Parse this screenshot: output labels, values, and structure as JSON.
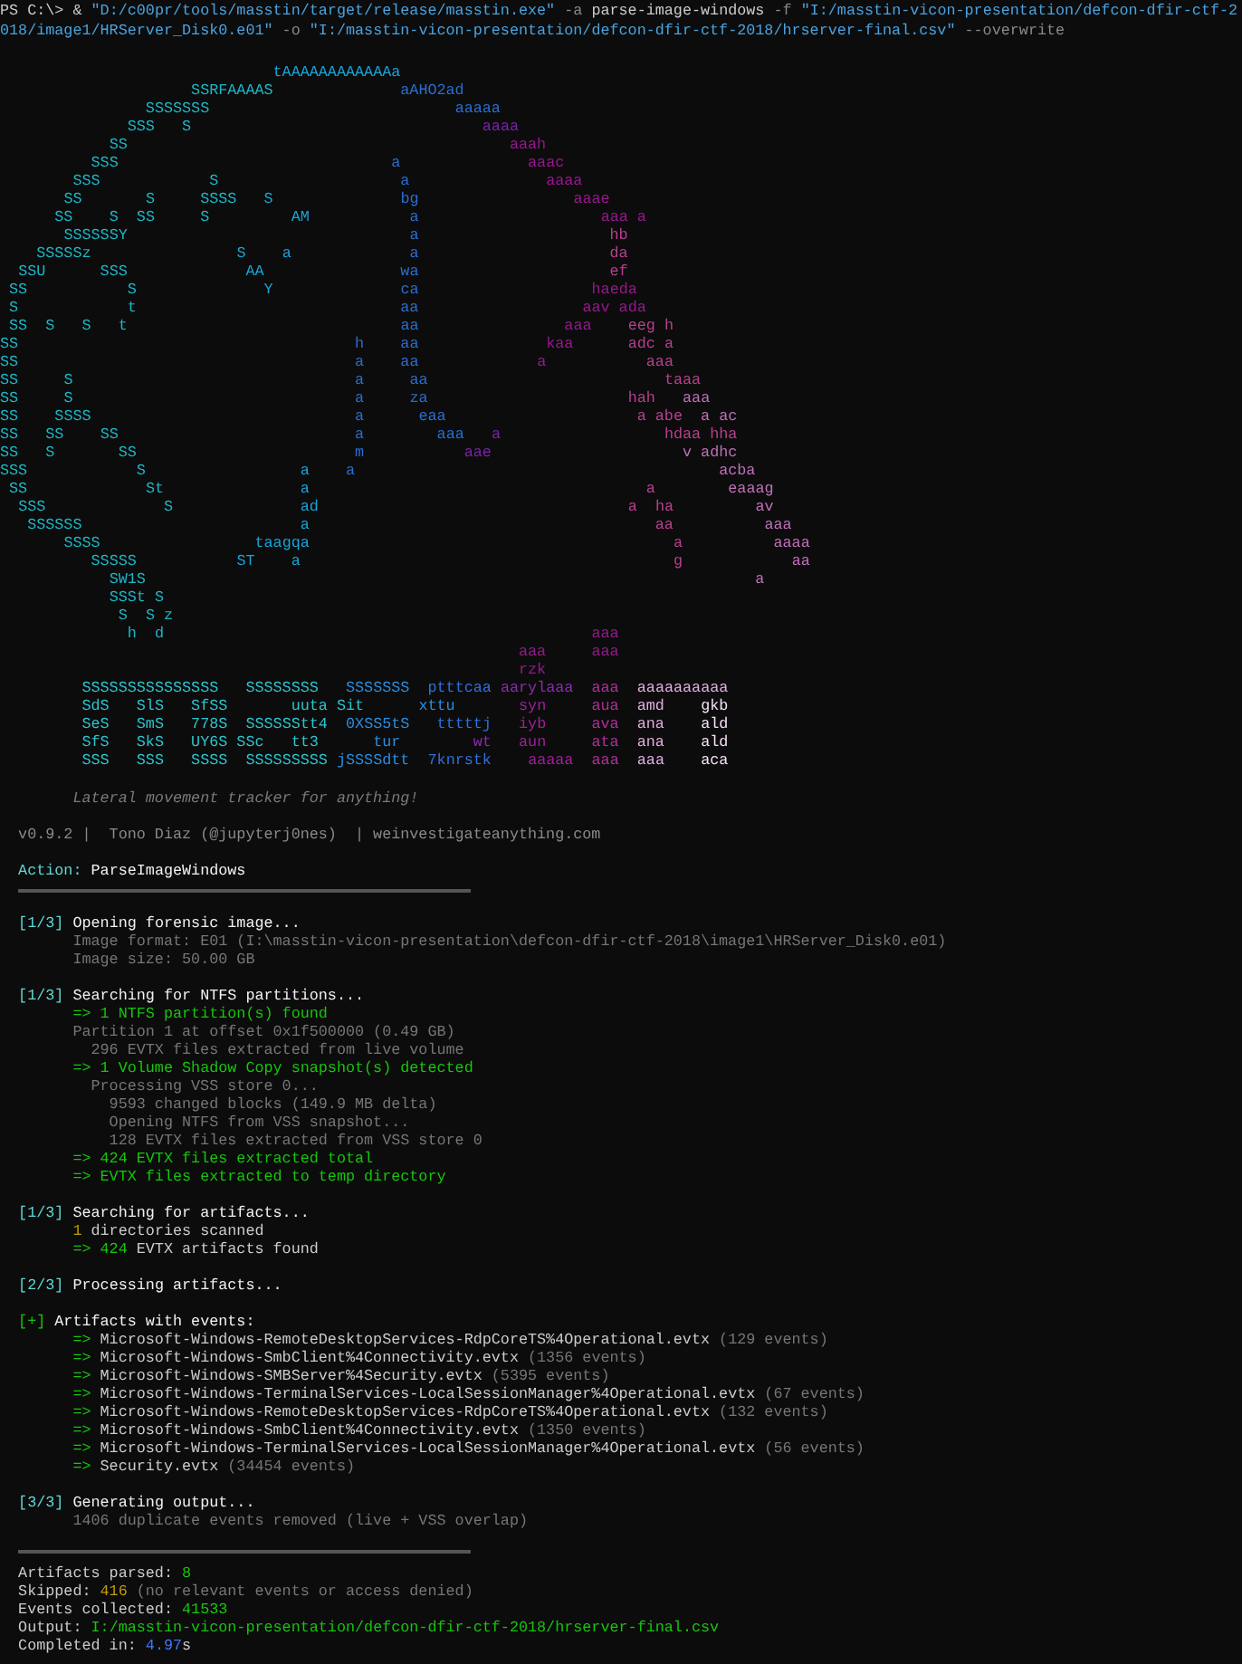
{
  "command": [
    {
      "text": "PS C:\\> & ",
      "kind": "plain"
    },
    {
      "text": "\"D:/c00pr/tools/masstin/target/release/masstin.exe\"",
      "kind": "string"
    },
    {
      "text": " -a ",
      "kind": "flag"
    },
    {
      "text": "parse-image-windows",
      "kind": "plain"
    },
    {
      "text": " -f ",
      "kind": "flag"
    },
    {
      "text": "\"I:/masstin-vicon-presentation/defcon-dfir-ctf-2018/image1/HRServer_Disk0.e01\"",
      "kind": "string"
    },
    {
      "text": " -o ",
      "kind": "flag"
    },
    {
      "text": "\"I:/masstin-vicon-presentation/defcon-dfir-ctf-2018/hrserver-final.csv\"",
      "kind": "string"
    },
    {
      "text": " --overwrite",
      "kind": "flag"
    }
  ],
  "banner": {
    "art": [
      [
        "                              tAAAAAAAAAAAAa"
      ],
      [
        "                     SSRFAAAAS",
        "              aAHO2ad"
      ],
      [
        "                SSSSSSS",
        "                           aaaaa"
      ],
      [
        "              SSS",
        "   S",
        "                                aaaa"
      ],
      [
        "            SS",
        "                                          aaah"
      ],
      [
        "          SSS",
        "                              a",
        "              aaac"
      ],
      [
        "        SSS",
        "            S",
        "                    a",
        "               aaaa"
      ],
      [
        "       SS",
        "       S",
        "     SSSS",
        "   S",
        "              bg",
        "                 aaae"
      ],
      [
        "      SS",
        "    S",
        "  SS",
        "     S",
        "         AM",
        "           a",
        "                    aaa a"
      ],
      [
        "       SSSSSSY",
        "                               a",
        "                     hb"
      ],
      [
        "    SSSSSz",
        "                S",
        "    a",
        "             a",
        "                     da"
      ],
      [
        "  SSU",
        "      SSS",
        "             AA",
        "               wa",
        "                     ef"
      ],
      [
        " SS",
        "           S",
        "              Y",
        "              ca",
        "                   haeda"
      ],
      [
        " S",
        "            t",
        "                             aa",
        "                  aav ada"
      ],
      [
        " SS",
        "  S",
        "   S",
        "   t",
        "                              aa",
        "                aaa",
        "    eeg h"
      ],
      [
        "SS",
        "                                     h",
        "    aa",
        "              kaa",
        "      adc a"
      ],
      [
        "SS",
        "                                     a",
        "    aa",
        "             a",
        "           aaa"
      ],
      [
        "SS",
        "     S",
        "                               a",
        "     aa",
        "                          taaa"
      ],
      [
        "SS",
        "     S",
        "                               a",
        "     za",
        "                      hah",
        "   aaa"
      ],
      [
        "SS",
        "    SSSS",
        "                             a",
        "      eaa",
        "                     a abe",
        "  a ac"
      ],
      [
        "SS",
        "   SS",
        "    SS",
        "                          a",
        "        aaa",
        "   a",
        "                  hdaa hha"
      ],
      [
        "SS",
        "   S",
        "       SS",
        "                        m",
        "           aae",
        "                     v adhc"
      ],
      [
        "SSS",
        "            S",
        "                 a",
        "    a",
        "                                        acba"
      ],
      [
        " SS",
        "             St",
        "               a",
        "                                     a",
        "        eaaag"
      ],
      [
        "  SSS",
        "             S",
        "              ad",
        "                                  a",
        "  ha",
        "         av"
      ],
      [
        "   SSSSSS",
        "                        a",
        "                                      aa",
        "          aaa"
      ],
      [
        "       SSSS",
        "                 taagqa",
        "                                        a",
        "          aaaa"
      ],
      [
        "          SSSSS",
        "           ST",
        "    a",
        "                                         g",
        "            aa"
      ],
      [
        "            SW1S",
        "                                                                   a"
      ],
      [
        "            SSSt S"
      ],
      [
        "             S",
        "  S z"
      ],
      [
        "              h",
        "  d",
        "                                               aaa"
      ],
      [
        "                                                         aaa",
        "     aaa"
      ],
      [
        "                                                         rzk"
      ],
      [
        "         SSSSSSSSSSSSSSS",
        "   SSSSSSSS",
        "   SSSSSSS",
        "  ptttcaa",
        " aarylaaa",
        "  aaa",
        "  aaaaaaaaaa"
      ],
      [
        "         SdS",
        "   SlS",
        "   SfSS",
        "       uuta Sit",
        "      xttu",
        "       syn",
        "     aua",
        "  amd",
        "    gkb"
      ],
      [
        "         SeS",
        "   SmS",
        "   778S",
        "  SSSSSStt4",
        "  0XSS5tS",
        "   tttttj",
        "   iyb",
        "     ava",
        "  ana",
        "    ald"
      ],
      [
        "         SfS",
        "   SkS",
        "   UY6S SSc",
        "   tt3",
        "      tur",
        "        wt",
        "   aun",
        "     ata",
        "  ana",
        "    ald"
      ],
      [
        "         SSS",
        "   SSS",
        "   SSSS",
        "  SSSSSSSSS",
        " jSSSSdtt",
        "  7knrstk",
        "    aaaaa",
        "  aaa",
        "  aaa",
        "    aca"
      ]
    ],
    "tagline": "Lateral movement tracker for anything!",
    "credits": "v0.9.2 |  Tono Diaz (@jupyterj0nes)  | weinvestigateanything.com"
  },
  "action": {
    "label": "Action:",
    "value": "ParseImageWindows"
  },
  "steps": [
    {
      "tag": {
        "text": "[1/3]",
        "kind": "accent"
      },
      "title": "Opening forensic image...",
      "lines": [
        {
          "parts": [
            {
              "text": "Image format: E01 (I:\\masstin-vicon-presentation\\defcon-dfir-ctf-2018\\image1\\HRServer_Disk0.e01)",
              "kind": "muted"
            }
          ]
        },
        {
          "parts": [
            {
              "text": "Image size: 50.00 GB",
              "kind": "muted"
            }
          ]
        }
      ]
    },
    {
      "tag": {
        "text": "[1/3]",
        "kind": "accent"
      },
      "title": "Searching for NTFS partitions...",
      "lines": [
        {
          "parts": [
            {
              "text": "=> 1 NTFS partition(s) found",
              "kind": "ok"
            }
          ]
        },
        {
          "parts": [
            {
              "text": "Partition 1 at offset 0x1f500000 (0.49 GB)",
              "kind": "muted"
            }
          ],
          "children": [
            {
              "parts": [
                {
                  "text": "296 EVTX files extracted from live volume",
                  "kind": "muted"
                }
              ]
            }
          ]
        },
        {
          "parts": [
            {
              "text": "=> 1 Volume Shadow Copy snapshot(s) detected",
              "kind": "ok"
            }
          ],
          "children": [
            {
              "parts": [
                {
                  "text": "Processing VSS store 0...",
                  "kind": "muted"
                }
              ],
              "children": [
                {
                  "parts": [
                    {
                      "text": "9593 changed blocks (149.9 MB delta)",
                      "kind": "muted"
                    }
                  ]
                },
                {
                  "parts": [
                    {
                      "text": "Opening NTFS from VSS snapshot...",
                      "kind": "muted"
                    }
                  ]
                },
                {
                  "parts": [
                    {
                      "text": "128 EVTX files extracted from VSS store 0",
                      "kind": "muted"
                    }
                  ]
                }
              ]
            }
          ]
        },
        {
          "parts": [
            {
              "text": "=> 424 EVTX files extracted total",
              "kind": "ok"
            }
          ]
        },
        {
          "parts": [
            {
              "text": "=> EVTX files extracted to temp directory",
              "kind": "ok"
            }
          ]
        }
      ]
    },
    {
      "tag": {
        "text": "[1/3]",
        "kind": "accent"
      },
      "title": "Searching for artifacts...",
      "lines": [
        {
          "parts": [
            {
              "text": "1",
              "kind": "warn"
            },
            {
              "text": " directories scanned",
              "kind": "plain"
            }
          ]
        },
        {
          "parts": [
            {
              "text": "=> 424",
              "kind": "ok"
            },
            {
              "text": " EVTX artifacts found",
              "kind": "plain"
            }
          ]
        }
      ]
    },
    {
      "tag": {
        "text": "[2/3]",
        "kind": "accent"
      },
      "title": "Processing artifacts..."
    },
    {
      "tag": {
        "text": "[+]",
        "kind": "ok"
      },
      "title": "Artifacts with events:",
      "lines": [
        {
          "parts": [
            {
              "text": "=> ",
              "kind": "ok"
            },
            {
              "text": "Microsoft-Windows-RemoteDesktopServices-RdpCoreTS%4Operational.evtx",
              "kind": "plain"
            },
            {
              "text": " (129 events)",
              "kind": "muted"
            }
          ]
        },
        {
          "parts": [
            {
              "text": "=> ",
              "kind": "ok"
            },
            {
              "text": "Microsoft-Windows-SmbClient%4Connectivity.evtx",
              "kind": "plain"
            },
            {
              "text": " (1356 events)",
              "kind": "muted"
            }
          ]
        },
        {
          "parts": [
            {
              "text": "=> ",
              "kind": "ok"
            },
            {
              "text": "Microsoft-Windows-SMBServer%4Security.evtx",
              "kind": "plain"
            },
            {
              "text": " (5395 events)",
              "kind": "muted"
            }
          ]
        },
        {
          "parts": [
            {
              "text": "=> ",
              "kind": "ok"
            },
            {
              "text": "Microsoft-Windows-TerminalServices-LocalSessionManager%4Operational.evtx",
              "kind": "plain"
            },
            {
              "text": " (67 events)",
              "kind": "muted"
            }
          ]
        },
        {
          "parts": [
            {
              "text": "=> ",
              "kind": "ok"
            },
            {
              "text": "Microsoft-Windows-RemoteDesktopServices-RdpCoreTS%4Operational.evtx",
              "kind": "plain"
            },
            {
              "text": " (132 events)",
              "kind": "muted"
            }
          ]
        },
        {
          "parts": [
            {
              "text": "=> ",
              "kind": "ok"
            },
            {
              "text": "Microsoft-Windows-SmbClient%4Connectivity.evtx",
              "kind": "plain"
            },
            {
              "text": " (1350 events)",
              "kind": "muted"
            }
          ]
        },
        {
          "parts": [
            {
              "text": "=> ",
              "kind": "ok"
            },
            {
              "text": "Microsoft-Windows-TerminalServices-LocalSessionManager%4Operational.evtx",
              "kind": "plain"
            },
            {
              "text": " (56 events)",
              "kind": "muted"
            }
          ]
        },
        {
          "parts": [
            {
              "text": "=> ",
              "kind": "ok"
            },
            {
              "text": "Security.evtx",
              "kind": "plain"
            },
            {
              "text": " (34454 events)",
              "kind": "muted"
            }
          ]
        }
      ]
    },
    {
      "tag": {
        "text": "[3/3]",
        "kind": "accent"
      },
      "title": "Generating output...",
      "lines": [
        {
          "parts": [
            {
              "text": "1406 duplicate events removed (live + VSS overlap)",
              "kind": "muted"
            }
          ]
        }
      ]
    }
  ],
  "summary": [
    {
      "parts": [
        {
          "text": "Artifacts parsed: ",
          "kind": "plain"
        },
        {
          "text": "8",
          "kind": "ok"
        }
      ]
    },
    {
      "parts": [
        {
          "text": "Skipped: ",
          "kind": "plain"
        },
        {
          "text": "416",
          "kind": "warn"
        },
        {
          "text": " (no relevant events or access denied)",
          "kind": "muted"
        }
      ]
    },
    {
      "parts": [
        {
          "text": "Events collected: ",
          "kind": "plain"
        },
        {
          "text": "41533",
          "kind": "ok"
        }
      ]
    },
    {
      "parts": [
        {
          "text": "Output: ",
          "kind": "plain"
        },
        {
          "text": "I:/masstin-vicon-presentation/defcon-dfir-ctf-2018/hrserver-final.csv",
          "kind": "ok"
        }
      ]
    },
    {
      "parts": [
        {
          "text": "Completed in: ",
          "kind": "plain"
        },
        {
          "text": "4.97",
          "kind": "info"
        },
        {
          "text": "s",
          "kind": "plain"
        }
      ]
    }
  ]
}
